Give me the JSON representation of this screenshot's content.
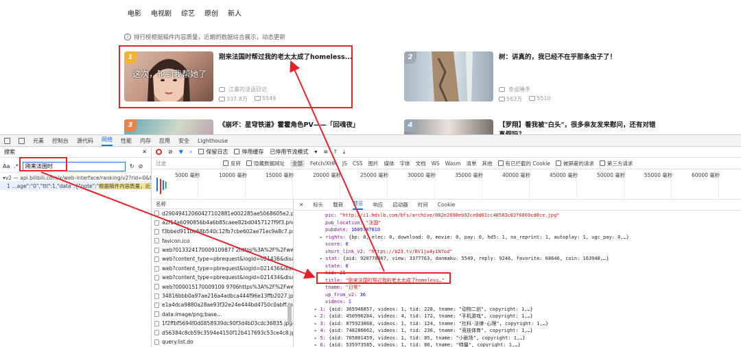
{
  "topnav": [
    "电影",
    "电视剧",
    "综艺",
    "原创",
    "新人"
  ],
  "notice": "排行榜根据稿件内容质量，近期的数据综合展示，动态更新",
  "cards": [
    {
      "rank": "1",
      "rank_color": "#f5b335",
      "thumb_text": "这次，轮到我帮她了",
      "title": "刚来法国时帮过我的老太太成了homeless...",
      "uploader": "江畫的法语日记",
      "views": "337.8万",
      "danmaku": "5549"
    },
    {
      "rank": "2",
      "rank_color": "#9faab5",
      "thumb_text": "",
      "title": "树：讲真的，我已经不在乎那条虫子了！",
      "uploader": "幸运睡手",
      "views": "563万",
      "danmaku": "5510"
    },
    {
      "rank": "3",
      "rank_color": "#e8834b",
      "thumb_text": "",
      "title": "《崩坏：星穹铁道》霍霍角色PV——「回魂夜」",
      "uploader": "",
      "views": "",
      "danmaku": ""
    },
    {
      "rank": "4",
      "rank_color": "#9aa7b6",
      "thumb_text": "",
      "title": "【罗翔】看我被\"白头\"，很多亲友发来慰问，还有对错真假吗？",
      "uploader": "",
      "views": "",
      "danmaku": ""
    }
  ],
  "devtools": {
    "tabs": [
      "元素",
      "控制台",
      "源代码",
      "网络",
      "性能",
      "内存",
      "应用",
      "安全",
      "Lighthouse"
    ],
    "active_tab": "网络",
    "search_title": "搜索",
    "search_value": "刚来法国时",
    "search_result_file": "▾v2 — api.bilibili.com/x/web-interface/ranking/v2?rid=0&type...",
    "search_result_line_prefix": "1  …age\":\"0\",\"ttl\":1,\"data\":{\"note\":\"",
    "search_result_line_hl": "根据稿件内容质量，近期的…",
    "toolbar": {
      "preserve_log": "保留日志",
      "disable_cache": "停用缓存",
      "throttle": "已停用节流模式"
    },
    "filter": {
      "label": "过滤",
      "invert": "反转",
      "hide_data": "隐藏数据网址",
      "types": [
        "全部",
        "Fetch/XHR",
        "JS",
        "CSS",
        "图片",
        "媒体",
        "字体",
        "文档",
        "WS",
        "Wasm",
        "清单",
        "其他"
      ],
      "blocked_cookies": "有已拦截的 Cookie",
      "blocked_requests": "被屏蔽的请求",
      "third_party": "第三方请求"
    },
    "timeline": [
      "5000 毫秒",
      "10000 毫秒",
      "15000 毫秒",
      "20000 毫秒",
      "25000 毫秒",
      "30000 毫秒",
      "35000 毫秒",
      "40000 毫秒",
      "45000 毫秒",
      "50000 毫秒",
      "55000 毫秒",
      "60000 毫秒"
    ],
    "list_header": "名称",
    "requests": [
      "d29049412060427102881e002285ae5068605e2.png",
      "a2f14a6090856b4a6b85caee82bd0457127f9f3.png",
      "f3bbed911be68b540c12fb7cbe602ae71ec9a8c7.png",
      "favicon.ico",
      "web?013324170009109877 2https%3A%2F%2Fwww...",
      "web?content_type=pbrequest&logid=021436&disa...",
      "web?content_type=pbrequest&logid=021436&disa...",
      "web?content_type=pbrequest&logid=021434&disa...",
      "web?000015170009109 9706https%3A%2F%2Fwww...",
      "34816bbb0a97ae216a4adbca444f96e13ffb2027.jpg",
      "e1a4dca9880a28ae93f32e24e444bd4750c0abff.jpg",
      "data:image/png;base...",
      "1f2ffbf5694f0d0858939dc90f3d4b03cdc36835.jpg@...",
      "d56384c8cb59c3594e4150f12b417693c53ce4c8.jpg...",
      "query.list.do"
    ],
    "detail_tabs": [
      "标头",
      "载荷",
      "预览",
      "响应",
      "启动器",
      "时间",
      "Cookie"
    ],
    "active_detail_tab": "预览",
    "json_lines": [
      {
        "indent": 1,
        "key": "pic",
        "val": "\"http://i1.hdslb.com/bfs/archive/082e2698eb92ce8d61cc48583c02f6869cd8ce.jpg\"",
        "type": "s"
      },
      {
        "indent": 1,
        "key": "pub_location",
        "val": "\"法国\"",
        "type": "s"
      },
      {
        "indent": 1,
        "key": "pubdate",
        "val": "1689787010",
        "type": "n"
      },
      {
        "indent": 0,
        "key": "rights",
        "val": "{bp: 0, elec: 0, download: 0, movie: 0, pay: 0, hd5: 1, no_reprint: 1, autoplay: 1, ugc_pay: 0,…}",
        "type": "o",
        "tri": "▸"
      },
      {
        "indent": 1,
        "key": "score",
        "val": "0",
        "type": "n"
      },
      {
        "indent": 1,
        "key": "short_link_v2",
        "val": "\"https://b23.tv/BV1ju4y1N7od\"",
        "type": "s"
      },
      {
        "indent": 0,
        "key": "stat",
        "val": "{aid: 920778367, view: 3377763, danmaku: 5549, reply: 9246, favorite: 68646, coin: 163948,…}",
        "type": "o",
        "tri": "▸"
      },
      {
        "indent": 1,
        "key": "state",
        "val": "0",
        "type": "n"
      },
      {
        "indent": 1,
        "key": "tid",
        "val": "21",
        "type": "n"
      },
      {
        "indent": 1,
        "key": "title",
        "val": "\"刚来法国时帮过我的老太太成了homeless…\"",
        "type": "s"
      },
      {
        "indent": 1,
        "key": "tname",
        "val": "\"日常\"",
        "type": "s"
      },
      {
        "indent": 1,
        "key": "up_from_v2",
        "val": "36",
        "type": "n"
      },
      {
        "indent": 1,
        "key": "videos",
        "val": "1",
        "type": "n"
      },
      {
        "indent": -1,
        "key": "1",
        "val": "{aid: 365946857, videos: 1, tid: 228, tname: \"动物二创\", copyright: 1,…}",
        "type": "o",
        "tri": "▸"
      },
      {
        "indent": -1,
        "key": "2",
        "val": "{aid: 450996284, videos: 4, tid: 172, tname: \"手机游戏\", copyright: 1,…}",
        "type": "o",
        "tri": "▸"
      },
      {
        "indent": -1,
        "key": "3",
        "val": "{aid: 875923868, videos: 1, tid: 124, tname: \"社科·法律·心理\", copyright: 1,…}",
        "type": "o",
        "tri": "▸"
      },
      {
        "indent": -1,
        "key": "4",
        "val": "{aid: 748286662, videos: 1, tid: 236, tname: \"竞技体育\", copyright: 1,…}",
        "type": "o",
        "tri": "▸"
      },
      {
        "indent": -1,
        "key": "5",
        "val": "{aid: 705801459, videos: 1, tid: 85, tname: \"小剧场\", copyright: 1,…}",
        "type": "o",
        "tri": "▸"
      },
      {
        "indent": -1,
        "key": "6",
        "val": "{aid: 535973585, videos: 1, tid: 86, tname: \"特摄\", copyright: 1,…}",
        "type": "o",
        "tri": "▸"
      }
    ]
  }
}
